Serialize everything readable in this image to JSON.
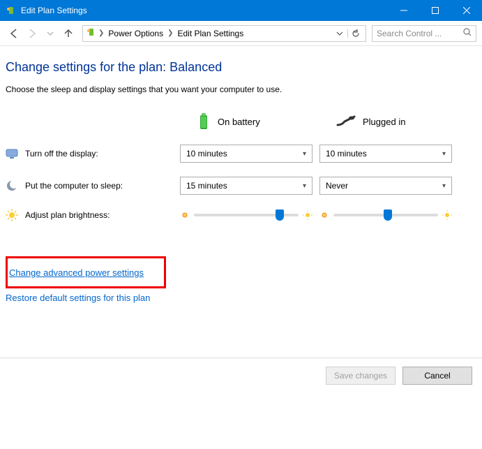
{
  "window": {
    "title": "Edit Plan Settings"
  },
  "breadcrumb": {
    "item1": "Power Options",
    "item2": "Edit Plan Settings"
  },
  "search": {
    "placeholder": "Search Control ..."
  },
  "heading": "Change settings for the plan: Balanced",
  "instruction": "Choose the sleep and display settings that you want your computer to use.",
  "columns": {
    "battery": "On battery",
    "plugged": "Plugged in"
  },
  "rows": {
    "display": {
      "label": "Turn off the display:",
      "battery": "10 minutes",
      "plugged": "10 minutes"
    },
    "sleep": {
      "label": "Put the computer to sleep:",
      "battery": "15 minutes",
      "plugged": "Never"
    },
    "bright": {
      "label": "Adjust plan brightness:"
    }
  },
  "brightness": {
    "battery_pct": 78,
    "plugged_pct": 48
  },
  "links": {
    "advanced": "Change advanced power settings",
    "restore": "Restore default settings for this plan"
  },
  "buttons": {
    "save": "Save changes",
    "cancel": "Cancel"
  }
}
